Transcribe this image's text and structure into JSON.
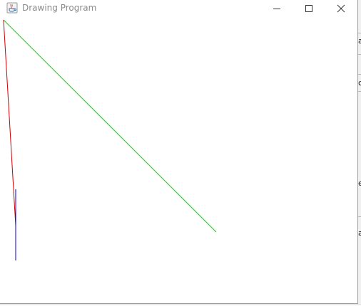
{
  "window": {
    "title": "Drawing Program",
    "icon": "java-coffee-cup-icon"
  },
  "controls": {
    "minimize_icon": "minimize-icon",
    "maximize_icon": "maximize-icon",
    "close_icon": "close-icon"
  },
  "drawing": {
    "lines": [
      {
        "color": "#00dd00",
        "name": "green-line"
      },
      {
        "color": "#cc0000",
        "name": "red-line"
      },
      {
        "color": "#0000cc",
        "name": "blue-line"
      }
    ]
  },
  "background_fragments": [
    "a",
    "c",
    "e",
    "a"
  ]
}
